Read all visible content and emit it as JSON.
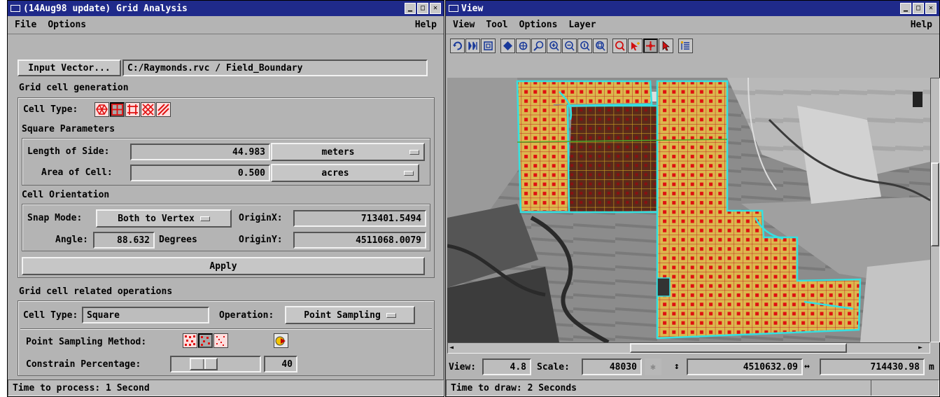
{
  "grid_window": {
    "title": "(14Aug98 update) Grid Analysis",
    "menu": {
      "file": "File",
      "options": "Options",
      "help": "Help"
    },
    "input_vector_button": "Input Vector...",
    "input_vector_path": "C:/Raymonds.rvc / Field_Boundary",
    "generation_heading": "Grid cell generation",
    "cell_type_label": "Cell Type:",
    "square_params_heading": "Square Parameters",
    "length_label": "Length of Side:",
    "length_value": "44.983",
    "length_unit": "meters",
    "area_label": "Area of Cell:",
    "area_value": "0.500",
    "area_unit": "acres",
    "orientation_heading": "Cell Orientation",
    "snap_label": "Snap Mode:",
    "snap_value": "Both to Vertex",
    "originx_label": "OriginX:",
    "originx_value": "713401.5494",
    "angle_label": "Angle:",
    "angle_value": "88.632",
    "degrees_label": "Degrees",
    "originy_label": "OriginY:",
    "originy_value": "4511068.0079",
    "apply_button": "Apply",
    "related_heading": "Grid cell related operations",
    "cell_type2_label": "Cell Type:",
    "cell_type2_value": "Square",
    "operation_label": "Operation:",
    "operation_value": "Point Sampling",
    "sampling_label": "Point Sampling Method:",
    "constrain_label": "Constrain Percentage:",
    "constrain_value": "40",
    "constrain_slider_fraction": 0.4,
    "status": "Time to process: 1 Second"
  },
  "view_window": {
    "title": "View",
    "menu": {
      "view": "View",
      "tool": "Tool",
      "options": "Options",
      "layer": "Layer",
      "help": "Help"
    },
    "view_label": "View:",
    "view_value": "4.8",
    "scale_label": "Scale:",
    "scale_value": "48030",
    "northing_value": "4510632.09",
    "easting_value": "714430.98",
    "unit": "m",
    "status": "Time to draw: 2 Seconds"
  },
  "colors": {
    "title_bar": "#1f2a8a",
    "panel": "#b4b4b4",
    "grid_cell": "#d9b84a",
    "grid_line": "#c81e1e",
    "boundary": "#35e0e0",
    "sample_point": "#e01010"
  }
}
